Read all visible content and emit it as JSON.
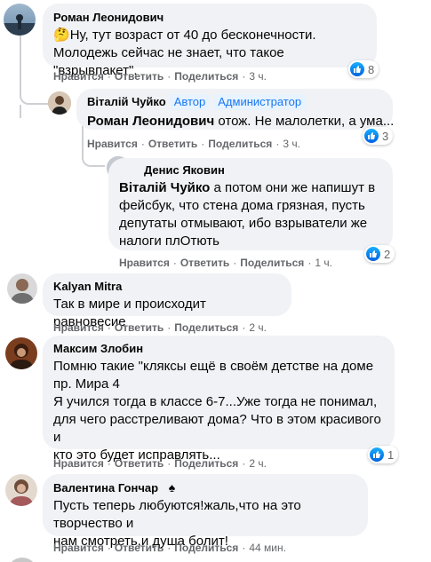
{
  "comments": [
    {
      "author": "Роман Леонидович",
      "emoji": "🤔",
      "lines": [
        "Ну, тут возраст от 40 до бесконечности.",
        "Молодежь сейчас не знает, что такое \"взрывпакет\"."
      ],
      "actions": {
        "like": "Нравится",
        "reply": "Ответить",
        "share": "Поделиться",
        "time": "3 ч."
      },
      "reactions": "8"
    },
    {
      "author": "Віталій Чуйко",
      "badges": [
        "Автор",
        "Администратор"
      ],
      "mention": "Роман Леонидович",
      "text": " отож. Не малолетки, а ума...",
      "actions": {
        "like": "Нравится",
        "reply": "Ответить",
        "share": "Поделиться",
        "time": "3 ч."
      },
      "reactions": "3"
    },
    {
      "author": "Денис Яковин",
      "mention": "Віталій Чуйко",
      "line1_rest": " а потом они же напишут в",
      "lines": [
        "фейсбук, что стена дома грязная, пусть",
        "депутаты отмывают, ибо взрыватели же",
        "налоги плОтють"
      ],
      "actions": {
        "like": "Нравится",
        "reply": "Ответить",
        "share": "Поделиться",
        "time": "1 ч."
      },
      "reactions": "2"
    },
    {
      "author": "Kalyan Mitra",
      "lines": [
        "Так в мире и происходит равновесие"
      ],
      "actions": {
        "like": "Нравится",
        "reply": "Ответить",
        "share": "Поделиться",
        "time": "2 ч."
      }
    },
    {
      "author": "Максим Злобин",
      "lines": [
        "Помню такие \"кляксы ещё в своём детстве на доме",
        "пр. Мира 4",
        "Я учился тогда в классе 6-7...Уже тогда не понимал,",
        "для чего расстреливают дома? Что в этом красивого и",
        "кто это будет исправлять..."
      ],
      "actions": {
        "like": "Нравится",
        "reply": "Ответить",
        "share": "Поделиться",
        "time": "2 ч."
      },
      "reactions": "1"
    },
    {
      "author": "Валентина Гончар",
      "lines": [
        "Пусть теперь любуются!жаль,что на это творчество и",
        "нам смотреть,и душа болит!"
      ],
      "actions": {
        "like": "Нравится",
        "reply": "Ответить",
        "share": "Поделиться",
        "time": "44 мин."
      }
    }
  ],
  "separator": "·",
  "colors": {
    "bubble": "#f0f2f5",
    "meta": "#65676b",
    "badge_text": "#1877f2",
    "like_blue": "#1877f2"
  }
}
